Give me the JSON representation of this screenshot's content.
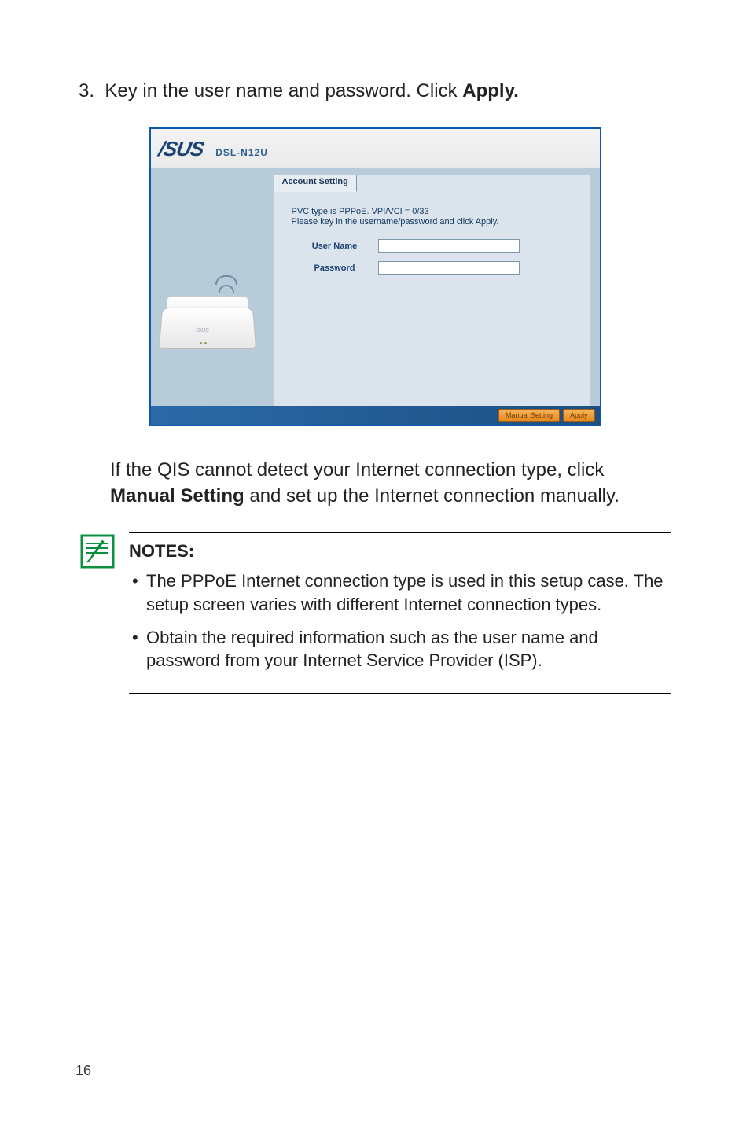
{
  "step": {
    "number": "3.",
    "text_before_bold": "Key in the user name and password. Click ",
    "bold_word": "Apply."
  },
  "screenshot": {
    "brand": "/SUS",
    "model": "DSL-N12U",
    "tab_label": "Account Setting",
    "pvc_line": "PVC type is PPPoE. VPI/VCI = 0/33",
    "instruct_line": "Please key in the username/password and click Apply.",
    "field_user_label": "User Name",
    "field_user_value": "",
    "field_pass_label": "Password",
    "field_pass_value": "",
    "btn_manual": "Manual Setting",
    "btn_apply": "Apply"
  },
  "after_paragraph": {
    "line1": "If the QIS cannot detect your Internet connection type, click",
    "bold": "Manual Setting",
    "tail": " and set up the Internet connection manually."
  },
  "notes": {
    "heading": "NOTES:",
    "items": [
      "The PPPoE Internet connection type is used in this setup case. The setup screen varies with different Internet connection types.",
      "Obtain the required information such as the user name and password from your Internet Service Provider (ISP)."
    ]
  },
  "page_number": "16"
}
